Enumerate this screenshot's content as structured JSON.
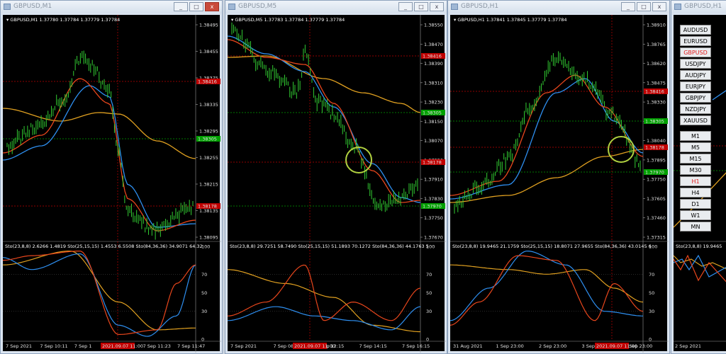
{
  "windows": [
    {
      "title": "GBPUSD,M1",
      "header": "GBPUSD,M1  1.37780 1.37784 1.37779 1.37784",
      "osc_header": "Sto(23,8,8) 2.6266 1.4819  Sto(25,15,15) 1.4553 6.5508  Sto(84,36,36) 34.9071 64.32",
      "price_ticks": [
        "1.38495",
        "1.38455",
        "1.38375",
        "1.38335",
        "1.38295",
        "1.38255",
        "1.38215",
        "1.38135",
        "1.38095"
      ],
      "price_tags": [
        {
          "value": "1.38416",
          "color": "#c00000"
        },
        {
          "value": "1.38305",
          "color": "#00a000"
        },
        {
          "value": "1.38178",
          "color": "#c00000"
        }
      ],
      "osc_ticks": [
        "100",
        "70",
        "50",
        "30",
        "0"
      ],
      "time_ticks": [
        "7 Sep 2021",
        "7 Sep 10:11",
        "7 Sep 1",
        "9",
        "7 Sep 11:23",
        "7 Sep 11:47"
      ],
      "time_tag": "2021.09.07 11:00",
      "buttons": {
        "minimize": "_",
        "restore": "□",
        "close": "x"
      }
    },
    {
      "title": "GBPUSD,M5",
      "header": "GBPUSD,M5  1.37783 1.37784 1.37779 1.37784",
      "osc_header": "Sto(23,8,8) 29.7251 58.7490  Sto(25,15,15) 51.1893 70.1272  Sto(84,36,36) 44.1763 5",
      "price_ticks": [
        "1.38550",
        "1.38470",
        "1.38390",
        "1.38310",
        "1.38230",
        "1.38150",
        "1.38070",
        "1.37990",
        "1.37910",
        "1.37830",
        "1.37750",
        "1.37670"
      ],
      "price_tags": [
        {
          "value": "1.38416",
          "color": "#c00000"
        },
        {
          "value": "1.38305",
          "color": "#00a000"
        },
        {
          "value": "1.38178",
          "color": "#c00000"
        },
        {
          "value": "1.37970",
          "color": "#00a000"
        },
        {
          "value": "1.37784",
          "color": "#ffffff"
        }
      ],
      "osc_ticks": [
        "100",
        "70",
        "50",
        "30",
        "0"
      ],
      "time_ticks": [
        "7 Sep 2021",
        "7 Sep 08:15",
        "7 Sep 12:15",
        "7 Sep 14:15",
        "7 Sep 16:15"
      ],
      "time_tag": "2021.09.07 11:00",
      "buttons": {
        "minimize": "_",
        "restore": "□",
        "close": "x"
      }
    },
    {
      "title": "GBPUSD,H1",
      "header": "GBPUSD,H1  1.37841 1.37845 1.37779 1.37784",
      "osc_header": "Sto(23,8,8) 19.9465 21.1759  Sto(25,15,15) 18.8071 27.9655  Sto(84,36,36) 43.0145 6",
      "price_ticks": [
        "1.38910",
        "1.38765",
        "1.38620",
        "1.38475",
        "1.38330",
        "1.38185",
        "1.38040",
        "1.37895",
        "1.37750",
        "1.37605",
        "1.37460",
        "1.37315"
      ],
      "price_tags": [
        {
          "value": "1.38416",
          "color": "#c00000"
        },
        {
          "value": "1.38305",
          "color": "#00a000"
        },
        {
          "value": "1.38178",
          "color": "#c00000"
        },
        {
          "value": "1.37970",
          "color": "#00a000"
        },
        {
          "value": "1.37784",
          "color": "#ffffff"
        }
      ],
      "osc_ticks": [
        "100",
        "70",
        "50",
        "30",
        "0"
      ],
      "time_ticks": [
        "31 Aug 2021",
        "1 Sep 23:00",
        "2 Sep 23:00",
        "3 Sep 23:00",
        "6 Sep 23:00"
      ],
      "time_tag": "2021.09.07 11:00",
      "buttons": {
        "minimize": "_",
        "restore": "□",
        "close": "x"
      }
    },
    {
      "title": "GBPUSD,H1",
      "osc_header": "Sto(23,8,8) 19.9465",
      "time_ticks": [
        "2 Sep 2021"
      ],
      "symbols": [
        "AUDUSD",
        "EURUSD",
        "GBPUSD",
        "USDJPY",
        "AUDJPY",
        "EURJPY",
        "GBPJPY",
        "NZDJPY",
        "XAUUSD"
      ],
      "active_symbol": "GBPUSD",
      "timeframes": [
        "M1",
        "M5",
        "M15",
        "M30",
        "H1",
        "H4",
        "D1",
        "W1",
        "MN"
      ],
      "active_timeframe": "H1"
    }
  ],
  "colors": {
    "candle": "#32cd32",
    "fast": "#e8461c",
    "mid": "#2e8ff0",
    "slow": "#e0a020",
    "sto_red": "#e8461c",
    "sto_blue": "#2e8ff0",
    "sto_orange": "#e0a020",
    "circle": "#b0d040"
  }
}
